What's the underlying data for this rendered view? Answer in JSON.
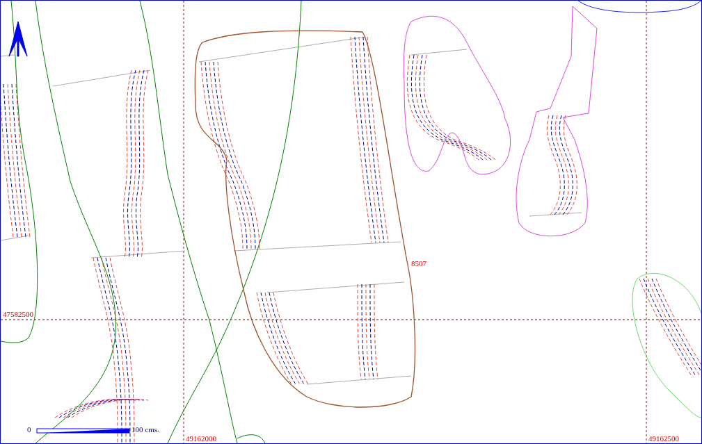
{
  "map": {
    "parcel_label": "8507",
    "grid_labels": [
      {
        "text": "47582500"
      },
      {
        "text": "49162000"
      },
      {
        "text": "49162500"
      }
    ],
    "scale_bar": {
      "start": "0",
      "end": "100 cms."
    }
  }
}
